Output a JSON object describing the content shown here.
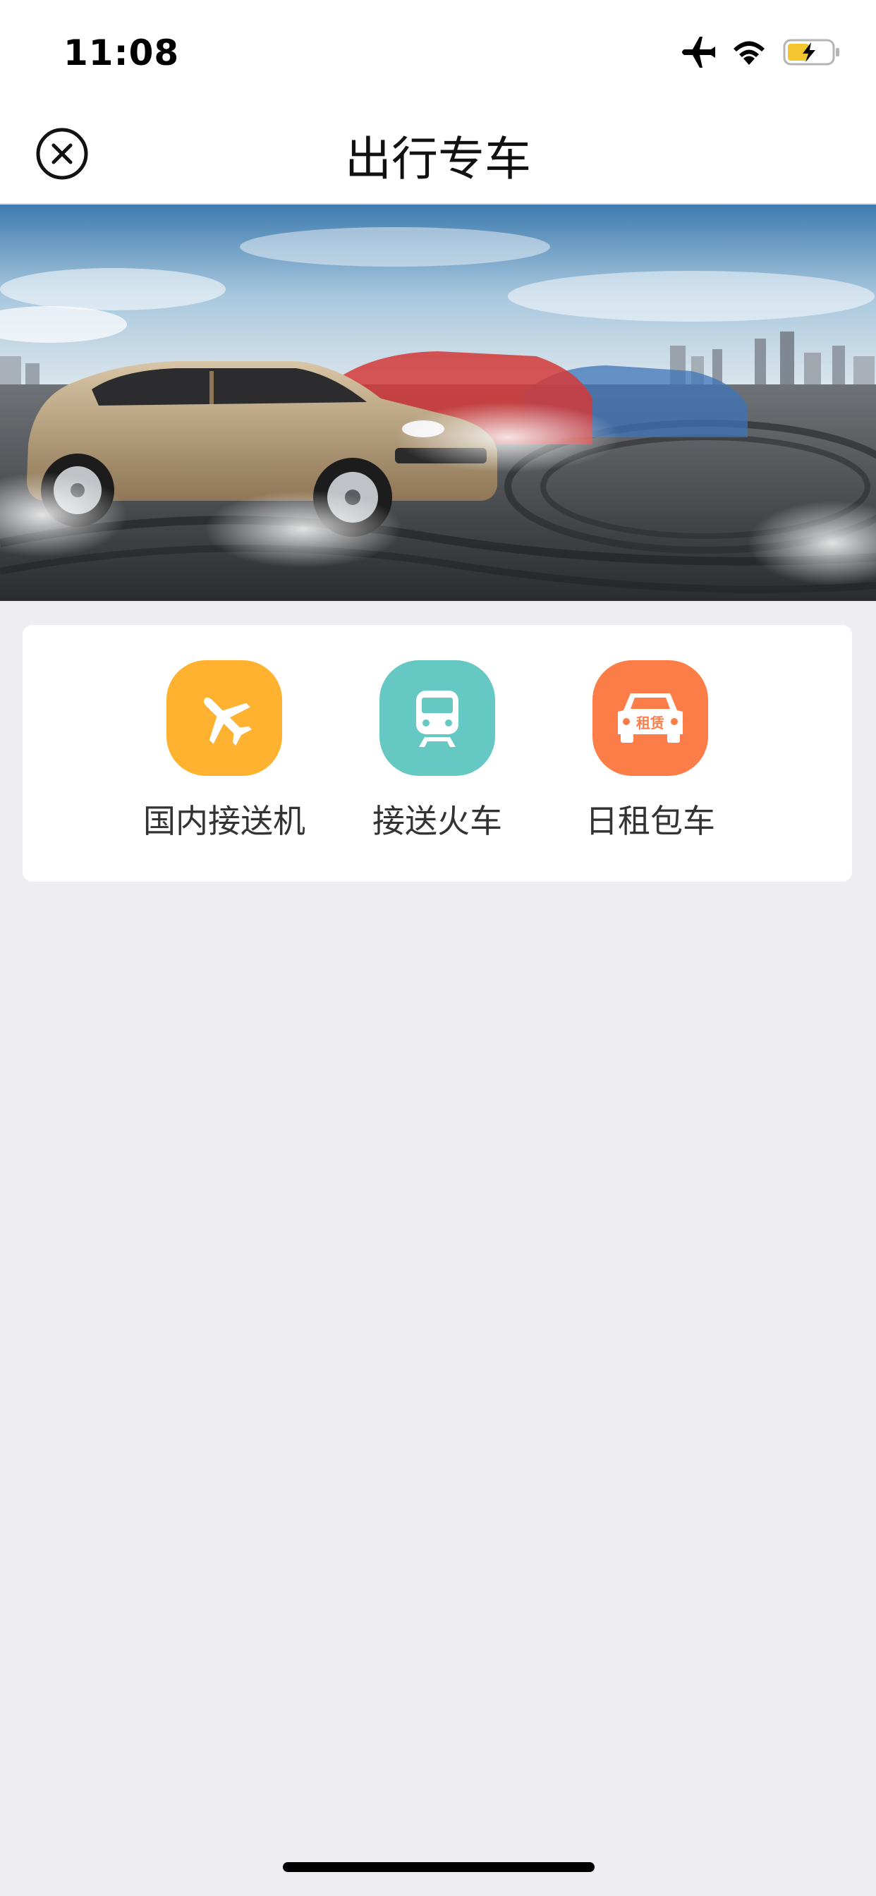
{
  "status_bar": {
    "time": "11:08",
    "icons": [
      "airplane-mode-icon",
      "wifi-icon",
      "battery-charging-icon"
    ]
  },
  "nav": {
    "title": "出行专车",
    "close_icon": "close-circle-icon"
  },
  "banner": {
    "description_icon": "cars-banner-image"
  },
  "services": [
    {
      "label": "国内接送机",
      "icon": "airplane-icon",
      "color": "#FEB22F"
    },
    {
      "label": "接送火车",
      "icon": "train-icon",
      "color": "#66C8C2"
    },
    {
      "label": "日租包车",
      "icon": "rental-car-icon",
      "color": "#FD7D48",
      "icon_text": "租赁"
    }
  ],
  "colors": {
    "background": "#EEEDF2",
    "card": "#FFFFFF",
    "text_primary": "#111111",
    "text_secondary": "#333333"
  }
}
